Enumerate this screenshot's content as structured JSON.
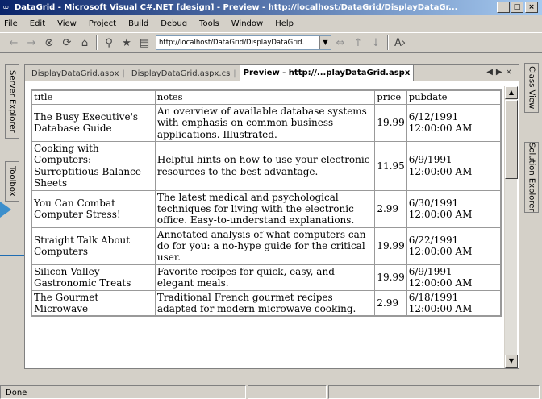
{
  "window": {
    "title": "DataGrid - Microsoft Visual C#.NET [design] - Preview - http://localhost/DataGrid/DisplayDataGr...",
    "app_icon": "vs-icon",
    "controls": [
      "_",
      "□",
      "×"
    ]
  },
  "menu": [
    "File",
    "Edit",
    "View",
    "Project",
    "Build",
    "Debug",
    "Tools",
    "Window",
    "Help"
  ],
  "toolbar": {
    "buttons": [
      "back-icon",
      "forward-icon",
      "stop-icon",
      "refresh-icon",
      "home-icon",
      "search-icon",
      "favorites-icon",
      "print-icon"
    ],
    "url": "http://localhost/DataGrid/DisplayDataGrid."
  },
  "left_dock": {
    "server_explorer": "Server Explorer",
    "toolbox": "Toolbox"
  },
  "right_dock": {
    "class_view": "Class View",
    "solution_explorer": "Solution Explorer"
  },
  "doc_tabs": [
    {
      "label": "DisplayDataGrid.aspx",
      "active": false
    },
    {
      "label": "DisplayDataGrid.aspx.cs",
      "active": false
    },
    {
      "label": "Preview - http://...playDataGrid.aspx",
      "active": true
    }
  ],
  "grid": {
    "columns": [
      "title",
      "notes",
      "price",
      "pubdate"
    ],
    "rows": [
      [
        "The Busy Executive's Database Guide",
        "An overview of available database systems with emphasis on common business applications. Illustrated.",
        "19.99",
        "6/12/1991 12:00:00 AM"
      ],
      [
        "Cooking with Computers: Surreptitious Balance Sheets",
        "Helpful hints on how to use your electronic resources to the best advantage.",
        "11.95",
        "6/9/1991 12:00:00 AM"
      ],
      [
        "You Can Combat Computer Stress!",
        "The latest medical and psychological techniques for living with the electronic office. Easy-to-understand explanations.",
        "2.99",
        "6/30/1991 12:00:00 AM"
      ],
      [
        "Straight Talk About Computers",
        "Annotated analysis of what computers can do for you: a no-hype guide for the critical user.",
        "19.99",
        "6/22/1991 12:00:00 AM"
      ],
      [
        "Silicon Valley Gastronomic Treats",
        "Favorite recipes for quick, easy, and elegant meals.",
        "19.99",
        "6/9/1991 12:00:00 AM"
      ],
      [
        "The Gourmet Microwave",
        "Traditional French gourmet recipes adapted for modern microwave cooking.",
        "2.99",
        "6/18/1991 12:00:00 AM"
      ]
    ]
  },
  "status": {
    "text": "Done"
  },
  "colors": {
    "titlebar_start": "#0a246a",
    "titlebar_end": "#a6caf0",
    "chrome": "#d4d0c8",
    "callout": "#1f6db3"
  }
}
